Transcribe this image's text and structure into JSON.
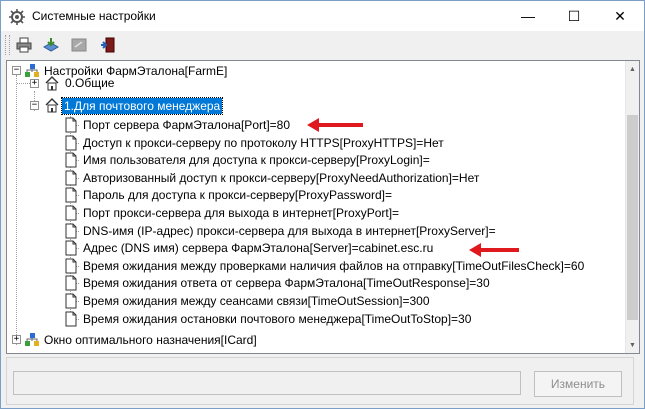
{
  "window": {
    "title": "Системные настройки",
    "minimize_glyph": "—",
    "maximize_glyph": "☐",
    "close_glyph": "✕"
  },
  "toolbar": {
    "buttons": [
      "print-icon",
      "export-icon",
      "disabled-edit-icon",
      "exit-door-icon"
    ]
  },
  "tree": {
    "root": "Настройки ФармЭталона[FarmE]",
    "general": "0.Общие",
    "mail_manager": "1.Для почтового менеджера",
    "items": [
      "Порт сервера ФармЭталона[Port]=80",
      "Доступ к прокси-серверу по протоколу HTTPS[ProxyHTTPS]=Нет",
      "Имя пользователя для доступа к прокси-серверу[ProxyLogin]=",
      "Авторизованный доступ к прокси-серверу[ProxyNeedAuthorization]=Нет",
      "Пароль для доступа к прокси-серверу[ProxyPassword]=",
      "Порт прокси-сервера для выхода в интернет[ProxyPort]=",
      "DNS-имя (IP-адрес) прокси-сервера для выхода в интернет[ProxyServer]=",
      "Адрес (DNS имя) сервера ФармЭталона[Server]=cabinet.esc.ru",
      "Время ожидания между проверками наличия файлов на отправку[TimeOutFilesCheck]=60",
      "Время ожидания ответа от сервера ФармЭталона[TimeOutResponse]=30",
      "Время ожидания между сеансами связи[TimeOutSession]=300",
      "Время ожидания остановки почтового менеджера[TimeOutToStop]=30"
    ],
    "icard": "Окно оптимального назначения[ICard]",
    "expand_glyph": "+",
    "collapse_glyph": "−"
  },
  "bottom": {
    "value": "",
    "change_label": "Изменить"
  },
  "colors": {
    "selection": "#0078d7",
    "annotation_arrow": "#e0191f"
  }
}
